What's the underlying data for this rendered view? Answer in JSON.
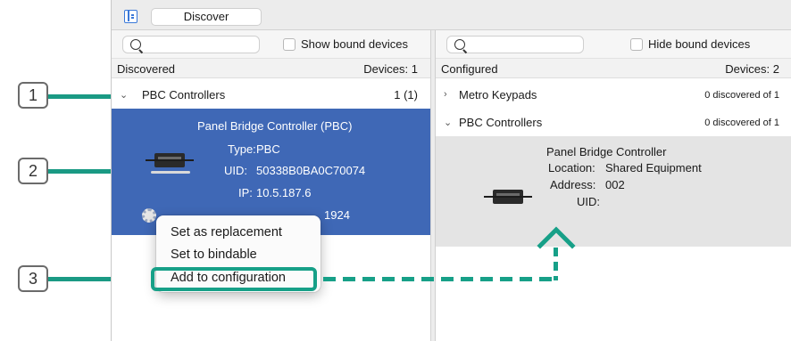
{
  "toolbar": {
    "tab_label": "Discover"
  },
  "left_pane": {
    "show_bound_label": "Show bound devices",
    "header_label": "Discovered",
    "header_count": "Devices: 1",
    "group": {
      "name": "PBC Controllers",
      "count": "1 (1)"
    },
    "selected_device": {
      "title": "Panel Bridge Controller (PBC)",
      "type_label": "Type:",
      "type_value": "PBC",
      "uid_label": "UID:",
      "uid_value": "50338B0BA0C70074",
      "ip_label": "IP:",
      "ip_value": "10.5.187.6",
      "partial_value": "1924"
    }
  },
  "context_menu": {
    "items": [
      "Set as replacement",
      "Set to bindable",
      "Add to configuration"
    ]
  },
  "right_pane": {
    "hide_bound_label": "Hide bound devices",
    "header_label": "Configured",
    "header_count": "Devices: 2",
    "groups": [
      {
        "name": "Metro Keypads",
        "count": "0 discovered of 1"
      },
      {
        "name": "PBC Controllers",
        "count": "0 discovered of 1"
      }
    ],
    "configured_device": {
      "title": "Panel Bridge Controller",
      "location_label": "Location:",
      "location_value": "Shared Equipment",
      "address_label": "Address:",
      "address_value": "002",
      "uid_label": "UID:"
    }
  },
  "callouts": [
    "1",
    "2",
    "3"
  ],
  "colors": {
    "accent_teal": "#17a088",
    "selection_blue": "#3f68b6"
  }
}
